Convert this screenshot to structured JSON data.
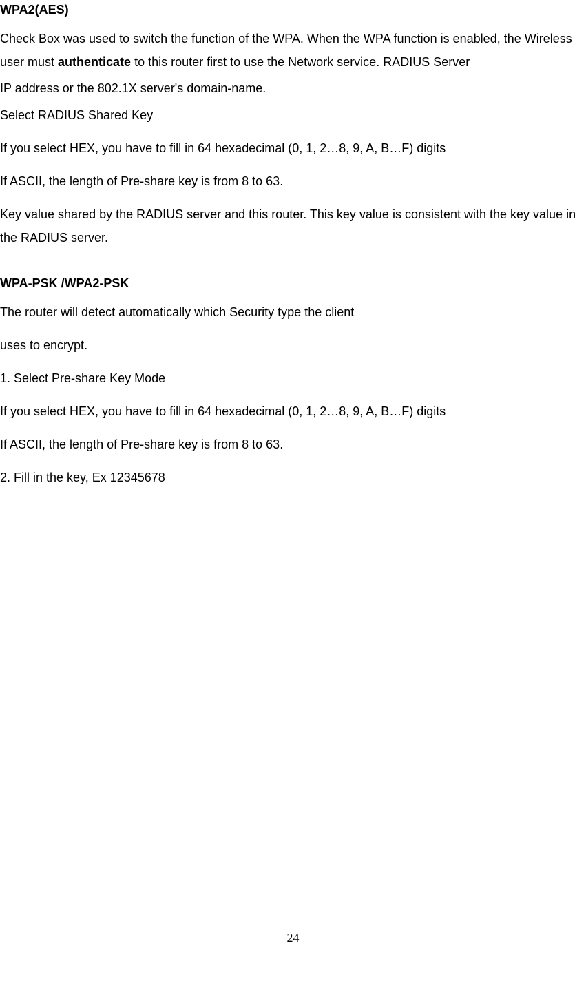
{
  "section1": {
    "heading": "WPA2(AES)",
    "p1_part1": "Check Box was used to switch the function of the WPA. When the WPA function is enabled, the Wireless user must ",
    "p1_bold": "authenticate",
    "p1_part2": " to this router first to use the Network service. RADIUS Server",
    "p2": "IP address or the 802.1X server's domain-name.",
    "p3": "Select RADIUS Shared Key",
    "p4": "If you select HEX, you have to fill in 64 hexadecimal (0, 1, 2…8, 9, A, B…F) digits",
    "p5": "If ASCII, the length of Pre-share key is from 8 to 63.",
    "p6": "Key value shared by the RADIUS server and this router. This key value is consistent with the key value in the RADIUS server."
  },
  "section2": {
    "heading": "WPA-PSK /WPA2-PSK",
    "p1": "The router will detect automatically   which Security type the client",
    "p2": "uses to encrypt.",
    "p3": "1. Select Pre-share Key Mode",
    "p4": "If you select HEX, you have to fill in 64 hexadecimal (0, 1, 2…8, 9, A, B…F) digits",
    "p5": "If ASCII, the length of Pre-share key is from 8 to 63.",
    "p6": "2. Fill in the key, Ex 12345678"
  },
  "pageNumber": "24"
}
